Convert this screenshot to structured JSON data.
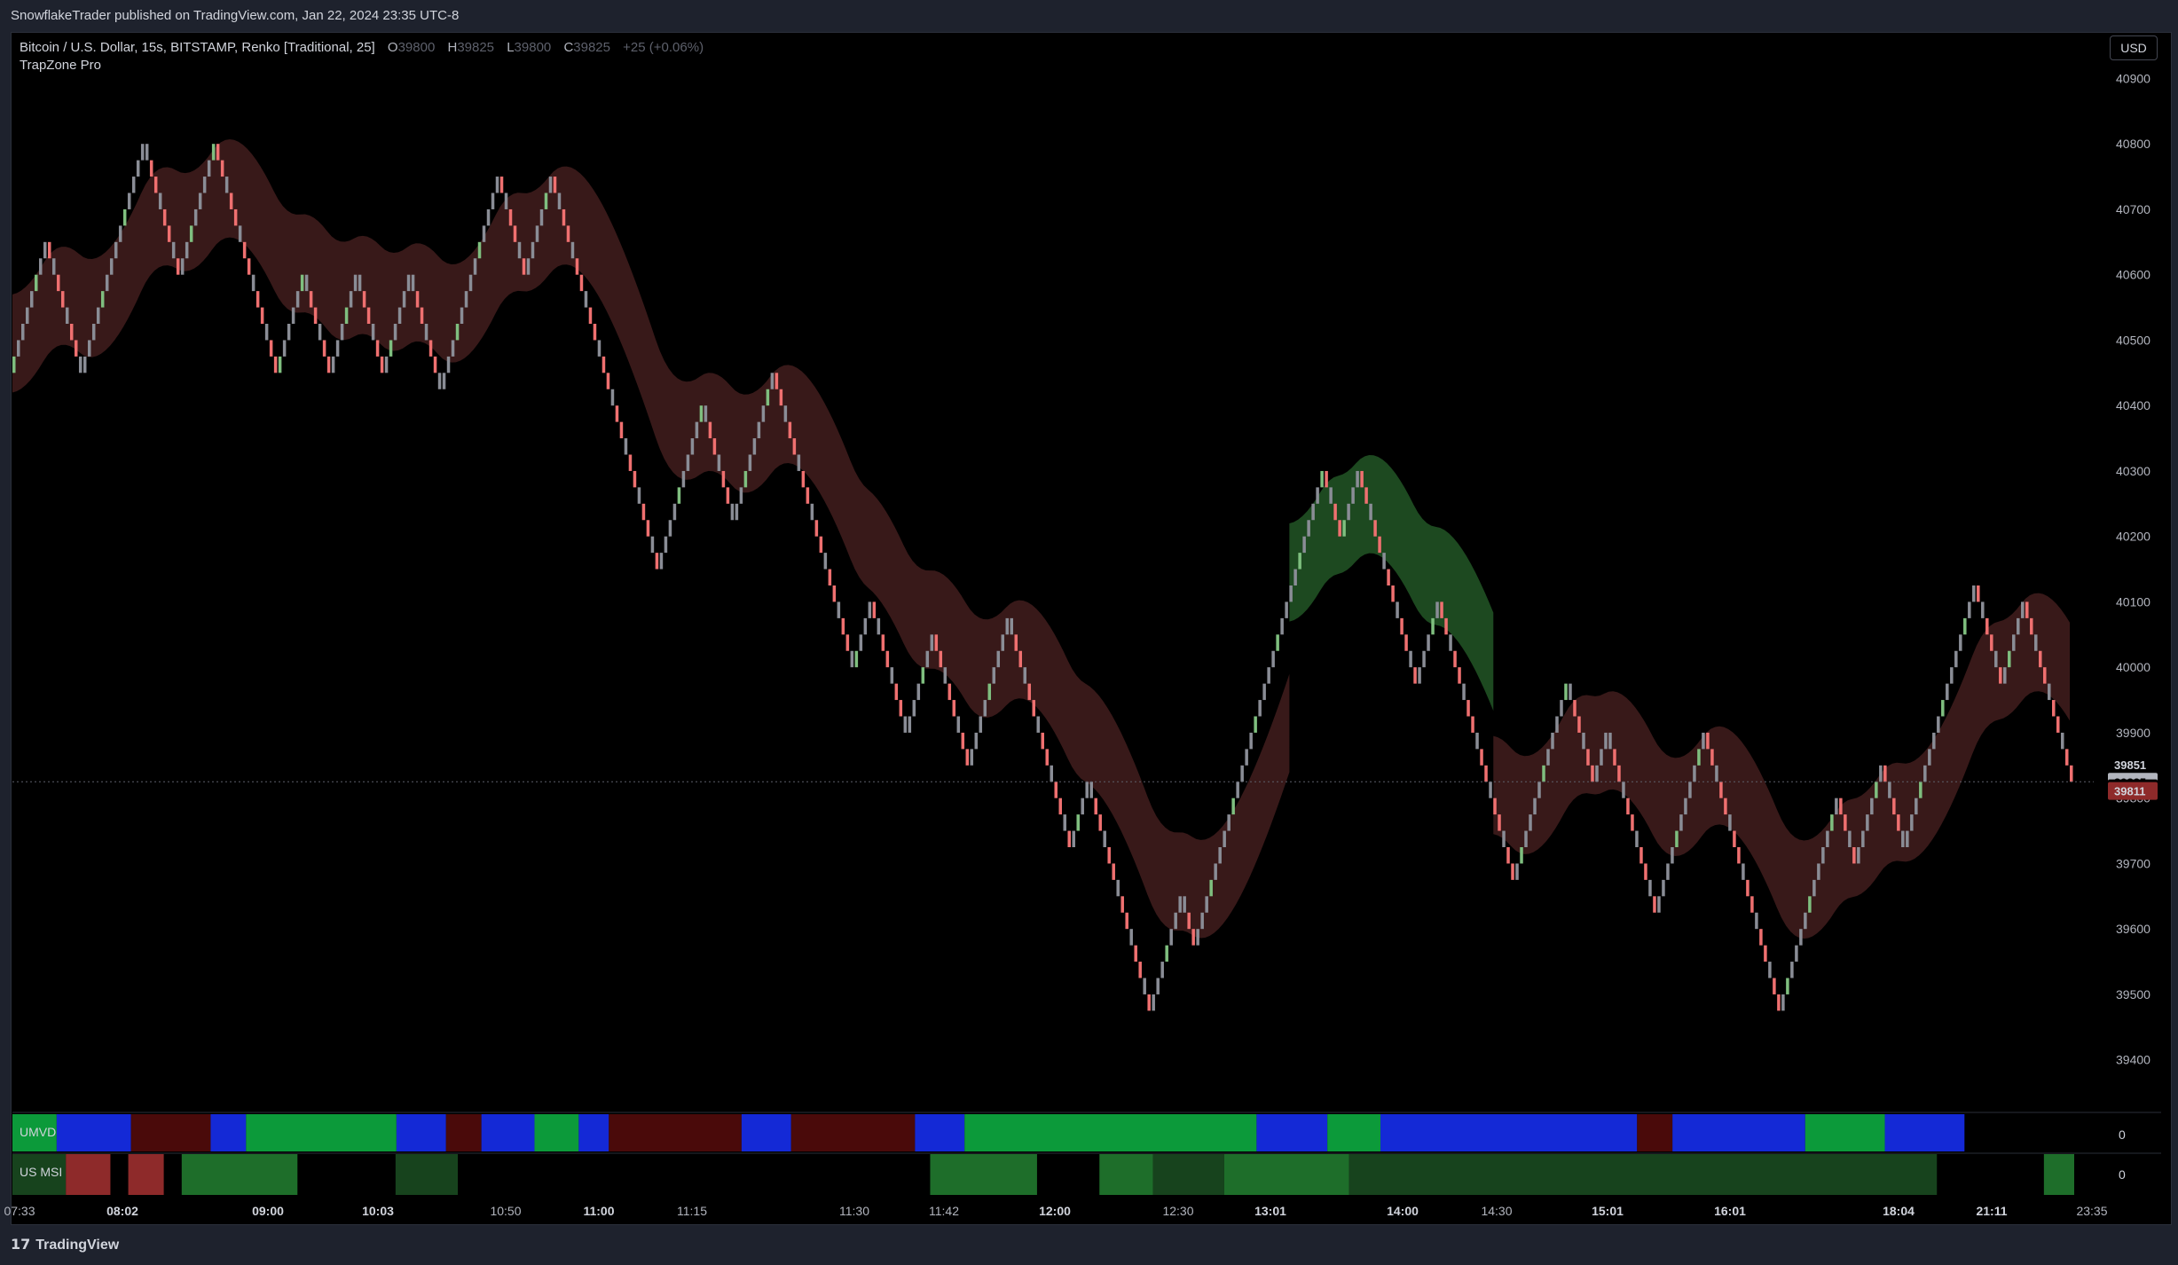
{
  "header": {
    "published": "SnowflakeTrader published on TradingView.com, Jan 22, 2024 23:35 UTC-8"
  },
  "legend": {
    "symbol": "Bitcoin / U.S. Dollar, 15s, BITSTAMP, Renko [Traditional, 25]",
    "o_label": "O",
    "o_value": "39800",
    "h_label": "H",
    "h_value": "39825",
    "l_label": "L",
    "l_value": "39800",
    "c_label": "C",
    "c_value": "39825",
    "change": "+25 (+0.06%)",
    "indicator": "TrapZone Pro"
  },
  "currency_button": "USD",
  "footer": {
    "brand": "TradingView"
  },
  "panes": {
    "umvd_label": "UMVD",
    "umvd_value": "0",
    "usmsi_label": "US MSI",
    "usmsi_value": "0"
  },
  "colors": {
    "up_brick": "#7fbf7f",
    "down_brick": "#ef7070",
    "neutral_brick": "#8a8d96",
    "bear_zone": "#3b1a1a",
    "bull_zone": "#1f4d22",
    "blue": "#1429d6",
    "green": "#0c9a3a",
    "maroon": "#4a0a0a",
    "dark_green": "#17431d",
    "mid_green": "#1e6e2a",
    "red": "#8e2a2a"
  },
  "chart_data": {
    "type": "renko",
    "brick_size": 25,
    "y_ticks": [
      40900,
      40800,
      40700,
      40600,
      40500,
      40400,
      40300,
      40200,
      40100,
      40000,
      39900,
      39800,
      39700,
      39600,
      39500,
      39400
    ],
    "ylim": [
      39325,
      40925
    ],
    "price_labels": [
      {
        "value": "39851",
        "y": 39851,
        "color": "#000000"
      },
      {
        "value": "39825",
        "y": 39825,
        "color": "#b2b5be"
      },
      {
        "value": "39815",
        "y": 39815,
        "color": "#000000"
      },
      {
        "value": "39811",
        "y": 39811,
        "color": "#8e2a2a"
      }
    ],
    "x_labels": [
      "07:33",
      "08:02",
      "09:00",
      "10:03",
      "10:50",
      "11:00",
      "11:15",
      "11:30",
      "11:42",
      "12:00",
      "12:30",
      "13:01",
      "14:00",
      "14:30",
      "15:01",
      "16:01",
      "18:04",
      "21:11",
      "23:35"
    ],
    "x_label_bold": [
      false,
      true,
      true,
      true,
      false,
      true,
      false,
      false,
      false,
      true,
      false,
      true,
      true,
      false,
      true,
      true,
      true,
      true,
      false
    ],
    "path": [
      40450,
      40650,
      40450,
      40800,
      40600,
      40800,
      40600,
      40450,
      40600,
      40450,
      40600,
      40450,
      40600,
      40425,
      40750,
      40600,
      40750,
      40600,
      40350,
      40150,
      40300,
      40400,
      40225,
      40450,
      40300,
      40000,
      40100,
      39900,
      40050,
      39850,
      40075,
      39725,
      39825,
      39725,
      39475,
      39650,
      39575,
      39775,
      39900,
      40000,
      40300,
      40200,
      40300,
      40050,
      39975,
      40100,
      39950,
      39950,
      39675,
      39975,
      39825,
      39900,
      39800,
      39625,
      39900,
      39675,
      39625,
      39475,
      39550,
      39800,
      39700,
      39850,
      39725,
      40000,
      40125,
      39975,
      40100,
      39875,
      39825
    ],
    "bear_zone_1": {
      "x": [
        0,
        0.55,
        0.62,
        0.7,
        0.9,
        1.0,
        1.15,
        1.25,
        1.3,
        1.5,
        1.55,
        2.0,
        2.4,
        2.5,
        3.0,
        3.2,
        3.6,
        3.8,
        4.0,
        5.0,
        5.5,
        5.6,
        6.0,
        6.2,
        6.5,
        6.6
      ],
      "top": [
        40750,
        40750,
        40750,
        40750,
        40750,
        40750,
        40750,
        40750,
        40750,
        40750,
        40750,
        40750,
        40750,
        40750,
        40750,
        40750,
        40750,
        40750,
        40750,
        40750,
        40750,
        40750,
        40750,
        40750,
        40750,
        40750
      ],
      "bottom": [
        40575,
        40575,
        40575,
        40575,
        40575,
        40575,
        40575,
        40575,
        40575,
        40575,
        40575,
        40575,
        40575,
        40575,
        40575,
        40575,
        40575,
        40575,
        40575,
        40575,
        40575,
        40575,
        40575,
        40575,
        40575,
        40575
      ]
    }
  }
}
